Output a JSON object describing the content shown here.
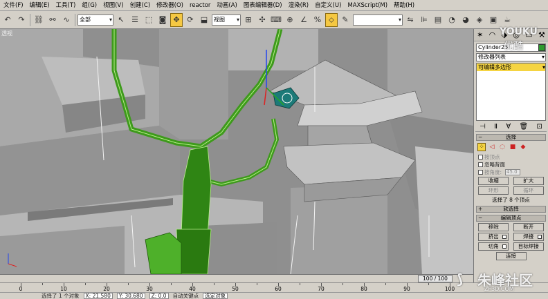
{
  "menu": [
    "文件(F)",
    "编辑(E)",
    "工具(T)",
    "组(G)",
    "视图(V)",
    "创建(C)",
    "修改器(O)",
    "reactor",
    "动画(A)",
    "图表编辑器(D)",
    "渲染(R)",
    "自定义(U)",
    "MAXScript(M)",
    "帮助(H)"
  ],
  "toolbar": {
    "selection_filter": "全部",
    "ref_coord": "视图"
  },
  "viewport": {
    "label": "透视"
  },
  "command_panel": {
    "object_name": "Cylinder25",
    "modifier_list": "修改器列表",
    "stack_item": "可编辑多边形",
    "selection_rollout": "选择",
    "checkboxes": {
      "by_vertex": "按顶点",
      "ignore_backfacing": "忽略背面",
      "by_angle": "按角度:",
      "angle_value": "45.0"
    },
    "buttons": {
      "shrink": "收缩",
      "grow": "扩大",
      "ring": "环形",
      "loop": "循环"
    },
    "selection_status": "选择了 8 个顶点",
    "soft_selection_rollout": "软选择",
    "edit_vertices_rollout": "编辑顶点",
    "remove": "移除",
    "break": "断开",
    "extrude": "挤出",
    "weld": "焊接",
    "chamfer": "切角",
    "target_weld": "目标焊接",
    "connect": "连接"
  },
  "timeline": {
    "frame_counter": "100 / 100",
    "ruler_labels": [
      "0",
      "10",
      "20",
      "30",
      "40",
      "50",
      "60",
      "70",
      "80",
      "90",
      "100"
    ]
  },
  "status": {
    "selected": "选择了 1 个对象",
    "x": "X: 21.580",
    "y": "Y: 30.680",
    "z": "Z: 0.0",
    "mode": "自动关键点",
    "filter": "选定对象"
  },
  "watermarks": {
    "youku": "YOUKU",
    "youku_cn": "优酷",
    "site": "朱峰社区",
    "site_url": "ZF3D.COM"
  },
  "colors": {
    "viewport_bg": "#8f8f8f",
    "tree_green": "#3e9a1c",
    "active_tool": "#f5c842",
    "object_color": "#2e9a2e"
  }
}
